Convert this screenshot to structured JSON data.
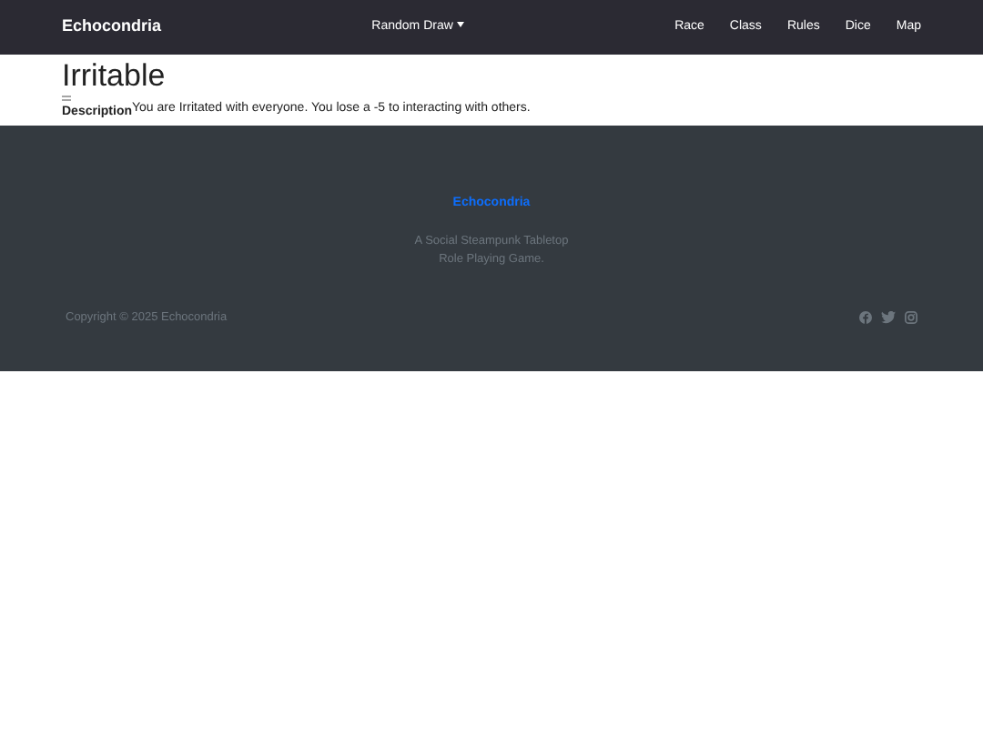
{
  "navbar": {
    "brand": "Echocondria",
    "dropdown": "Random Draw",
    "links": [
      "Race",
      "Class",
      "Rules",
      "Dice",
      "Map"
    ]
  },
  "card": {
    "title": "Irritable",
    "label": "Description",
    "text": "You are Irritated with everyone. You lose a -5 to interacting with others."
  },
  "footer": {
    "brand": "Echocondria",
    "tagline": [
      "A Social Steampunk Tabletop",
      "Role Playing Game."
    ],
    "copyright": "Copyright © 2025 Echocondria"
  }
}
